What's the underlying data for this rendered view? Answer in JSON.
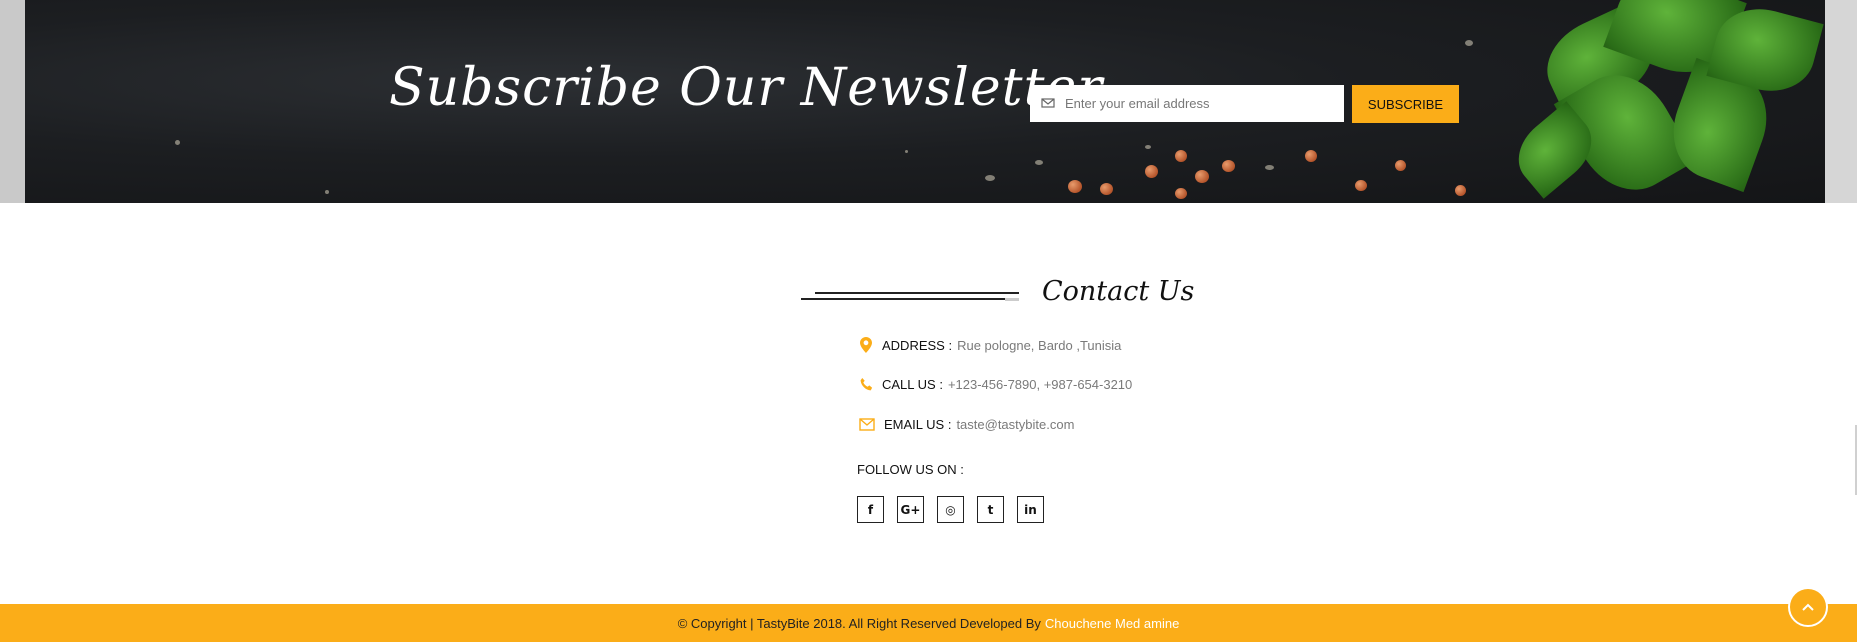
{
  "newsletter": {
    "title": "Subscribe Our Newsletter",
    "email_placeholder": "Enter your email address",
    "subscribe_label": "SUBSCRIBE",
    "icon": "envelope-icon"
  },
  "contact": {
    "title": "Contact Us",
    "address_label": "ADDRESS :",
    "address_value": "Rue pologne, Bardo ,Tunisia",
    "call_label": "CALL US :",
    "call_value": "+123-456-7890, +987-654-3210",
    "email_label": "EMAIL US :",
    "email_value": "taste@tastybite.com",
    "follow_label": "FOLLOW US ON :",
    "socials": [
      {
        "name": "facebook-icon",
        "glyph": "f"
      },
      {
        "name": "google-plus-icon",
        "glyph": "G+"
      },
      {
        "name": "instagram-icon",
        "glyph": "◎"
      },
      {
        "name": "twitter-icon",
        "glyph": "t"
      },
      {
        "name": "linkedin-icon",
        "glyph": "in"
      }
    ],
    "icon_color": "#fbad18"
  },
  "footer": {
    "copyright_text": "© Copyright | TastyBite 2018. All Right Reserved Developed By",
    "developer_link": "Chouchene Med amine"
  },
  "colors": {
    "accent": "#fbad18",
    "banner_bg": "#1c1e21"
  }
}
